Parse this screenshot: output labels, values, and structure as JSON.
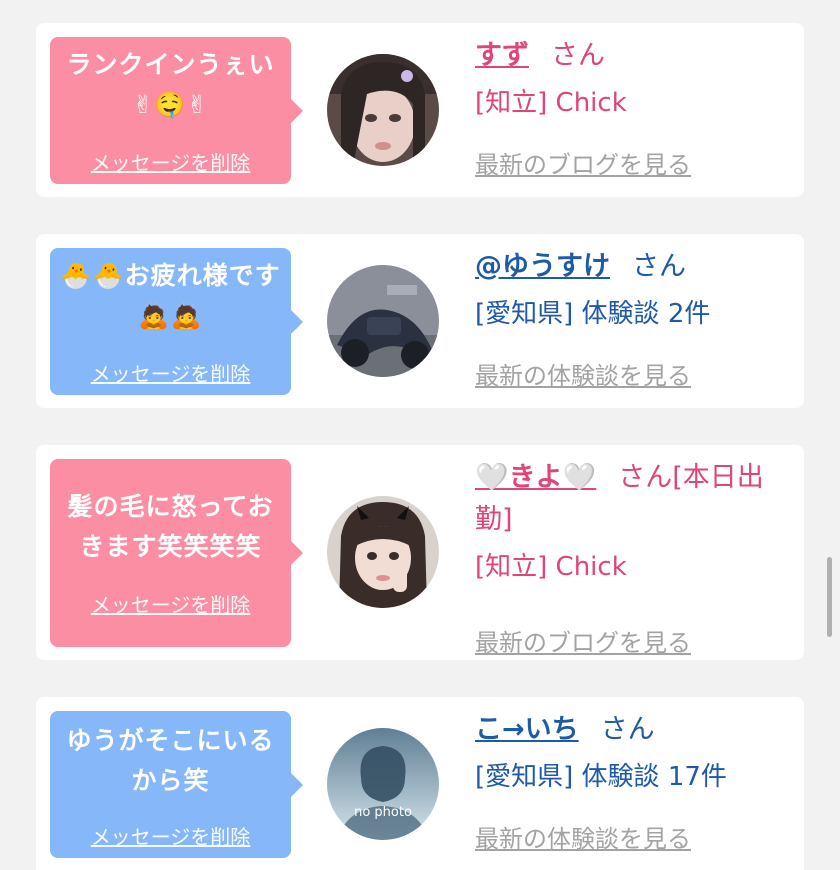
{
  "delete_label": "メッセージを削除",
  "cards": [
    {
      "message": "ランクインうぇい✌🤤✌",
      "name": "すず",
      "suffix": "さん",
      "detail": "[知立] Chick",
      "latest_link": "最新のブログを見る",
      "theme": "pink"
    },
    {
      "message": "🐣🐣お疲れ様です🙇🙇",
      "name": "@ゆうすけ",
      "suffix": "さん",
      "detail": "[愛知県] 体験談 2件",
      "latest_link": "最新の体験談を見る",
      "theme": "blue"
    },
    {
      "message": "髪の毛に怒っておきます笑笑笑笑",
      "name": "🤍きよ🤍",
      "suffix": "さん[本日出勤]",
      "detail": "[知立] Chick",
      "latest_link": "最新のブログを見る",
      "theme": "pink"
    },
    {
      "message": "ゆうがそこにいるから笑",
      "name": "こ→いち",
      "suffix": "さん",
      "detail": "[愛知県] 体験談 17件",
      "latest_link": "最新の体験談を見る",
      "theme": "blue",
      "avatar_text": "no photo"
    }
  ],
  "colors": {
    "pink_bubble": "#fb8ea3",
    "blue_bubble": "#86b7f8",
    "pink_text": "#e0457a",
    "blue_text": "#1f5aa8",
    "muted_link": "#a3a3a3"
  }
}
